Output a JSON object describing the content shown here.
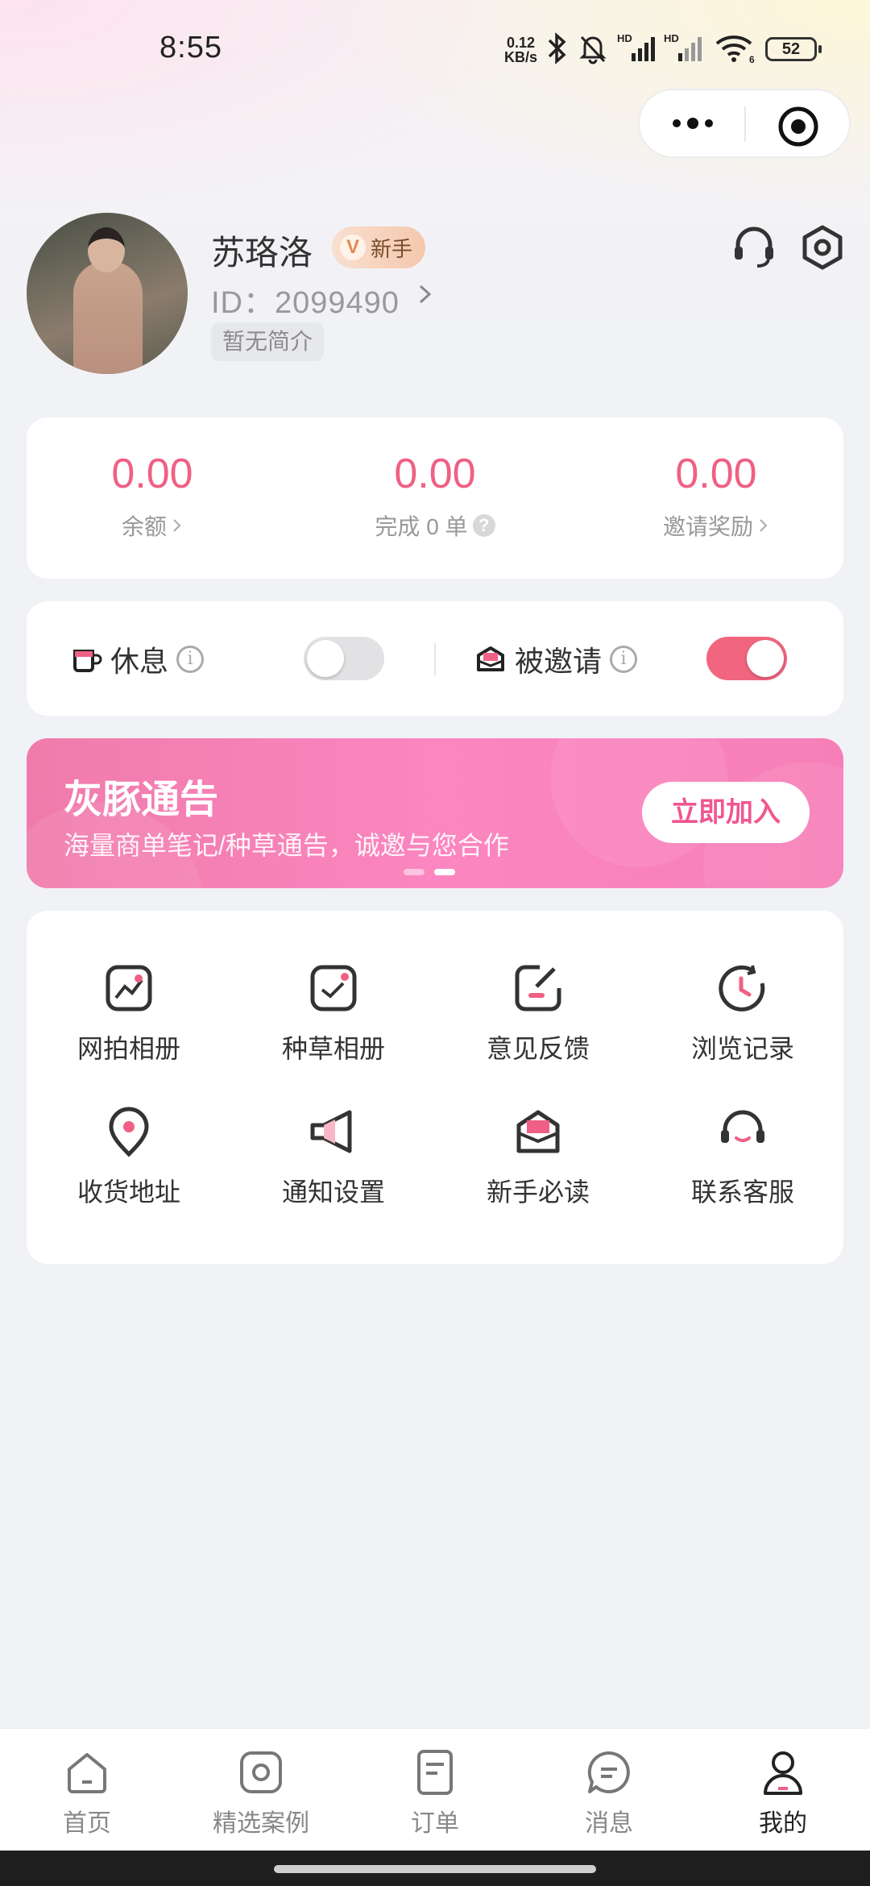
{
  "status_bar": {
    "time": "8:55",
    "net_speed_value": "0.12",
    "net_speed_unit": "KB/s",
    "signal1_label": "HD",
    "signal2_label": "HD",
    "wifi_label": "6",
    "battery": "52"
  },
  "profile": {
    "name": "苏珞洛",
    "badge": "新手",
    "badge_icon": "V",
    "id": "ID：2099490",
    "bio": "暂无简介"
  },
  "stats": [
    {
      "value": "0.00",
      "label": "余额"
    },
    {
      "value": "0.00",
      "label": "完成 0 单"
    },
    {
      "value": "0.00",
      "label": "邀请奖励"
    }
  ],
  "toggles": {
    "rest_label": "休息",
    "rest_on": false,
    "invited_label": "被邀请",
    "invited_on": true
  },
  "banner": {
    "title": "灰豚通告",
    "subtitle": "海量商单笔记/种草通告，诚邀与您合作",
    "button": "立即加入",
    "page_count": 2,
    "active_page": 2
  },
  "menu": [
    {
      "label": "网拍相册",
      "icon": "photo-album-icon"
    },
    {
      "label": "种草相册",
      "icon": "check-album-icon"
    },
    {
      "label": "意见反馈",
      "icon": "feedback-icon"
    },
    {
      "label": "浏览记录",
      "icon": "history-icon"
    },
    {
      "label": "收货地址",
      "icon": "location-icon"
    },
    {
      "label": "通知设置",
      "icon": "megaphone-icon"
    },
    {
      "label": "新手必读",
      "icon": "mail-icon"
    },
    {
      "label": "联系客服",
      "icon": "headset-icon"
    }
  ],
  "tabs": [
    {
      "label": "首页",
      "icon": "home-icon"
    },
    {
      "label": "精选案例",
      "icon": "camera-icon"
    },
    {
      "label": "订单",
      "icon": "document-icon"
    },
    {
      "label": "消息",
      "icon": "chat-icon"
    },
    {
      "label": "我的",
      "icon": "person-icon",
      "active": true
    }
  ],
  "colors": {
    "accent": "#f06084",
    "banner": "#f77fb8",
    "toggle_on": "#f1657f",
    "background": "#f1f2f6"
  }
}
